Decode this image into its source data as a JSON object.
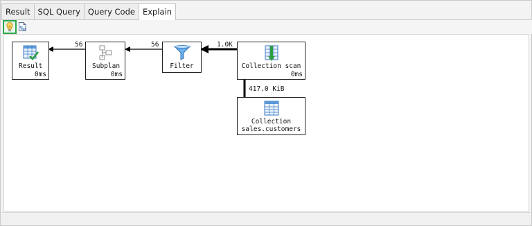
{
  "tabs": [
    {
      "label": "Result",
      "active": false
    },
    {
      "label": "SQL Query",
      "active": false
    },
    {
      "label": "Query Code",
      "active": false
    },
    {
      "label": "Explain",
      "active": true
    }
  ],
  "toolbar": {
    "buttons": [
      {
        "icon": "lightbulb-icon",
        "selected": true
      },
      {
        "icon": "export-plan-icon",
        "selected": false
      }
    ]
  },
  "plan": {
    "nodes": {
      "result": {
        "label": "Result",
        "time": "0ms",
        "icon": "result-grid-check-icon"
      },
      "subplan": {
        "label": "Subplan",
        "time": "0ms",
        "icon": "subplan-icon"
      },
      "filter": {
        "label": "Filter",
        "time": "",
        "icon": "filter-funnel-icon"
      },
      "scan": {
        "label": "Collection scan",
        "time": "0ms",
        "icon": "collection-scan-icon"
      },
      "collection": {
        "label_line1": "Collection",
        "label_line2": "sales.customers",
        "icon": "collection-table-icon"
      }
    },
    "edges": {
      "subplan_to_result": "56",
      "filter_to_subplan": "56",
      "scan_to_filter": "1.0K",
      "collection_to_scan": "417.0 KiB"
    }
  },
  "colors": {
    "selected_border": "#2aa84a",
    "tab_border": "#c6c6c6",
    "canvas_bg": "#ffffff"
  }
}
